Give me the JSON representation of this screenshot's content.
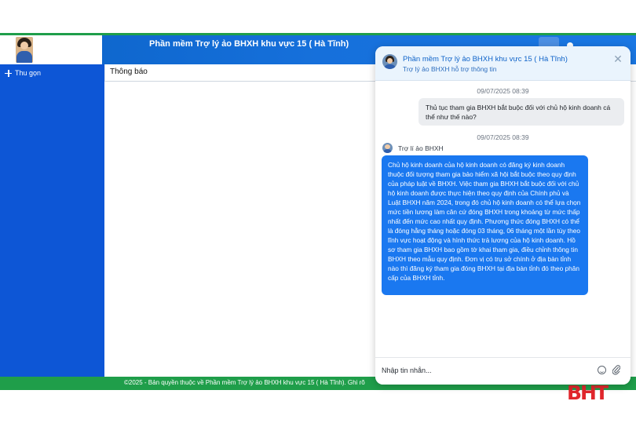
{
  "header": {
    "title": "Phần mềm Trợ lý ảo BHXH khu vực 15 ( Hà Tĩnh)"
  },
  "sidebar": {
    "collapse_label": "Thu gọn"
  },
  "main": {
    "tab_label": "Thông báo"
  },
  "footer": {
    "text": "©2025 - Bản quyền thuộc về Phần mềm Trợ lý ảo BHXH khu vực 15 ( Hà Tĩnh). Ghi rõ"
  },
  "watermark": "BHT",
  "chat": {
    "title": "Phần mềm Trợ lý ảo BHXH khu vực 15 ( Hà Tĩnh)",
    "subtitle": "Trợ lý ảo BHXH hỗ trợ thông tin",
    "messages": [
      {
        "timestamp": "09/07/2025 08:39",
        "sender": "user",
        "text": "Thủ tục tham gia BHXH bắt buộc đối với chủ hộ kinh doanh cá thể như thế nào?"
      },
      {
        "timestamp": "09/07/2025 08:39",
        "sender": "bot",
        "sender_name": "Trợ lí ảo BHXH",
        "text": "Chủ hộ kinh doanh của hộ kinh doanh có đăng ký kinh doanh thuộc đối tượng tham gia bảo hiểm xã hội bắt buộc theo quy định của pháp luật về BHXH. Việc tham gia BHXH bắt buộc đối với chủ hộ kinh doanh được thực hiện theo quy định của Chính phủ và Luật BHXH năm 2024, trong đó chủ hộ kinh doanh có thể lựa chọn mức tiền lương làm căn cứ đóng BHXH trong khoảng từ mức thấp nhất đến mức cao nhất quy định. Phương thức đóng BHXH có thể là đóng hằng tháng hoặc đóng 03 tháng, 06 tháng một lần tùy theo lĩnh vực hoạt động và hình thức trả lương của hộ kinh doanh. Hồ sơ tham gia BHXH bao gồm tờ khai tham gia, điều chỉnh thông tin BHXH theo mẫu quy định. Đơn vị có trụ sở chính ở địa bàn tỉnh nào thì đăng ký tham gia đóng BHXH tại địa bàn tỉnh đó theo phân cấp của BHXH tỉnh."
      }
    ],
    "input": {
      "value": "",
      "placeholder": "Nhập tin nhắn..."
    }
  },
  "icons": {
    "avatar": "avatar-icon",
    "collapse": "collapse-icon",
    "close": "close-icon",
    "emoji": "emoji-icon",
    "attach": "paperclip-icon"
  },
  "colors": {
    "header_blue": "#1670db",
    "sidebar_blue": "#0d56d6",
    "footer_green": "#1f9e4a",
    "bot_bubble": "#1a78f0",
    "user_bubble": "#ebedf0",
    "watermark_red": "#e1262c"
  }
}
